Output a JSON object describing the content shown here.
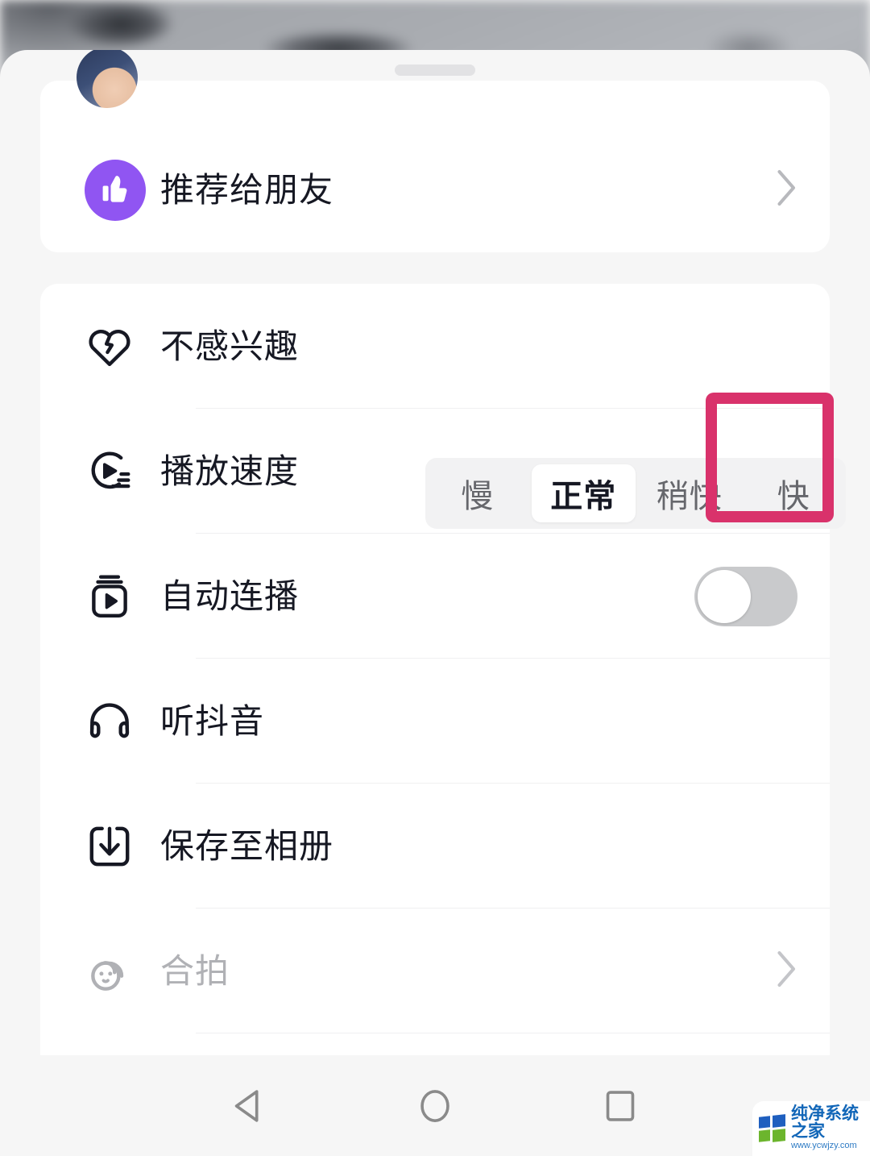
{
  "sheet": {
    "drag_handle": "drag-handle",
    "top_card": {
      "rows": [
        {
          "id": "recommend-to-friends",
          "label": "推荐给朋友",
          "icon": "thumbs-up-icon",
          "badge_color": "#9055f2",
          "accessory": "chevron-right-icon",
          "disabled": false
        }
      ]
    },
    "main_card": {
      "rows": [
        {
          "id": "not-interested",
          "label": "不感兴趣",
          "icon": "broken-heart-icon",
          "accessory": "none",
          "disabled": false
        },
        {
          "id": "playback-speed",
          "label": "播放速度",
          "icon": "playback-speed-icon",
          "accessory": "segmented-control",
          "disabled": false
        },
        {
          "id": "autoplay",
          "label": "自动连播",
          "icon": "autoplay-icon",
          "accessory": "toggle",
          "disabled": false
        },
        {
          "id": "listen-douyin",
          "label": "听抖音",
          "icon": "headphones-icon",
          "accessory": "none",
          "disabled": false
        },
        {
          "id": "save-to-album",
          "label": "保存至相册",
          "icon": "download-icon",
          "accessory": "none",
          "disabled": false
        },
        {
          "id": "duet",
          "label": "合拍",
          "icon": "duet-face-icon",
          "accessory": "chevron-right-icon",
          "disabled": true
        }
      ]
    }
  },
  "speed_control": {
    "options": [
      "慢",
      "正常",
      "稍快",
      "快"
    ],
    "selected": "正常",
    "selected_index": 1,
    "track_color": "#f2f2f3",
    "selected_pill_color": "#ffffff"
  },
  "autoplay_toggle": {
    "state": "off",
    "track_color": "#c9cacc",
    "knob_color": "#ffffff"
  },
  "annotation": {
    "target": "快",
    "color": "#d9326b",
    "shape": "rectangle-outline"
  },
  "navbar": {
    "buttons": [
      {
        "id": "back",
        "icon": "triangle-back-icon"
      },
      {
        "id": "home",
        "icon": "circle-home-icon"
      },
      {
        "id": "recents",
        "icon": "square-recents-icon"
      }
    ],
    "color": "#8a8a8a"
  },
  "watermark": {
    "title": "纯净系统之家",
    "url": "www.ycwjzy.com",
    "title_color": "#1166b8"
  }
}
